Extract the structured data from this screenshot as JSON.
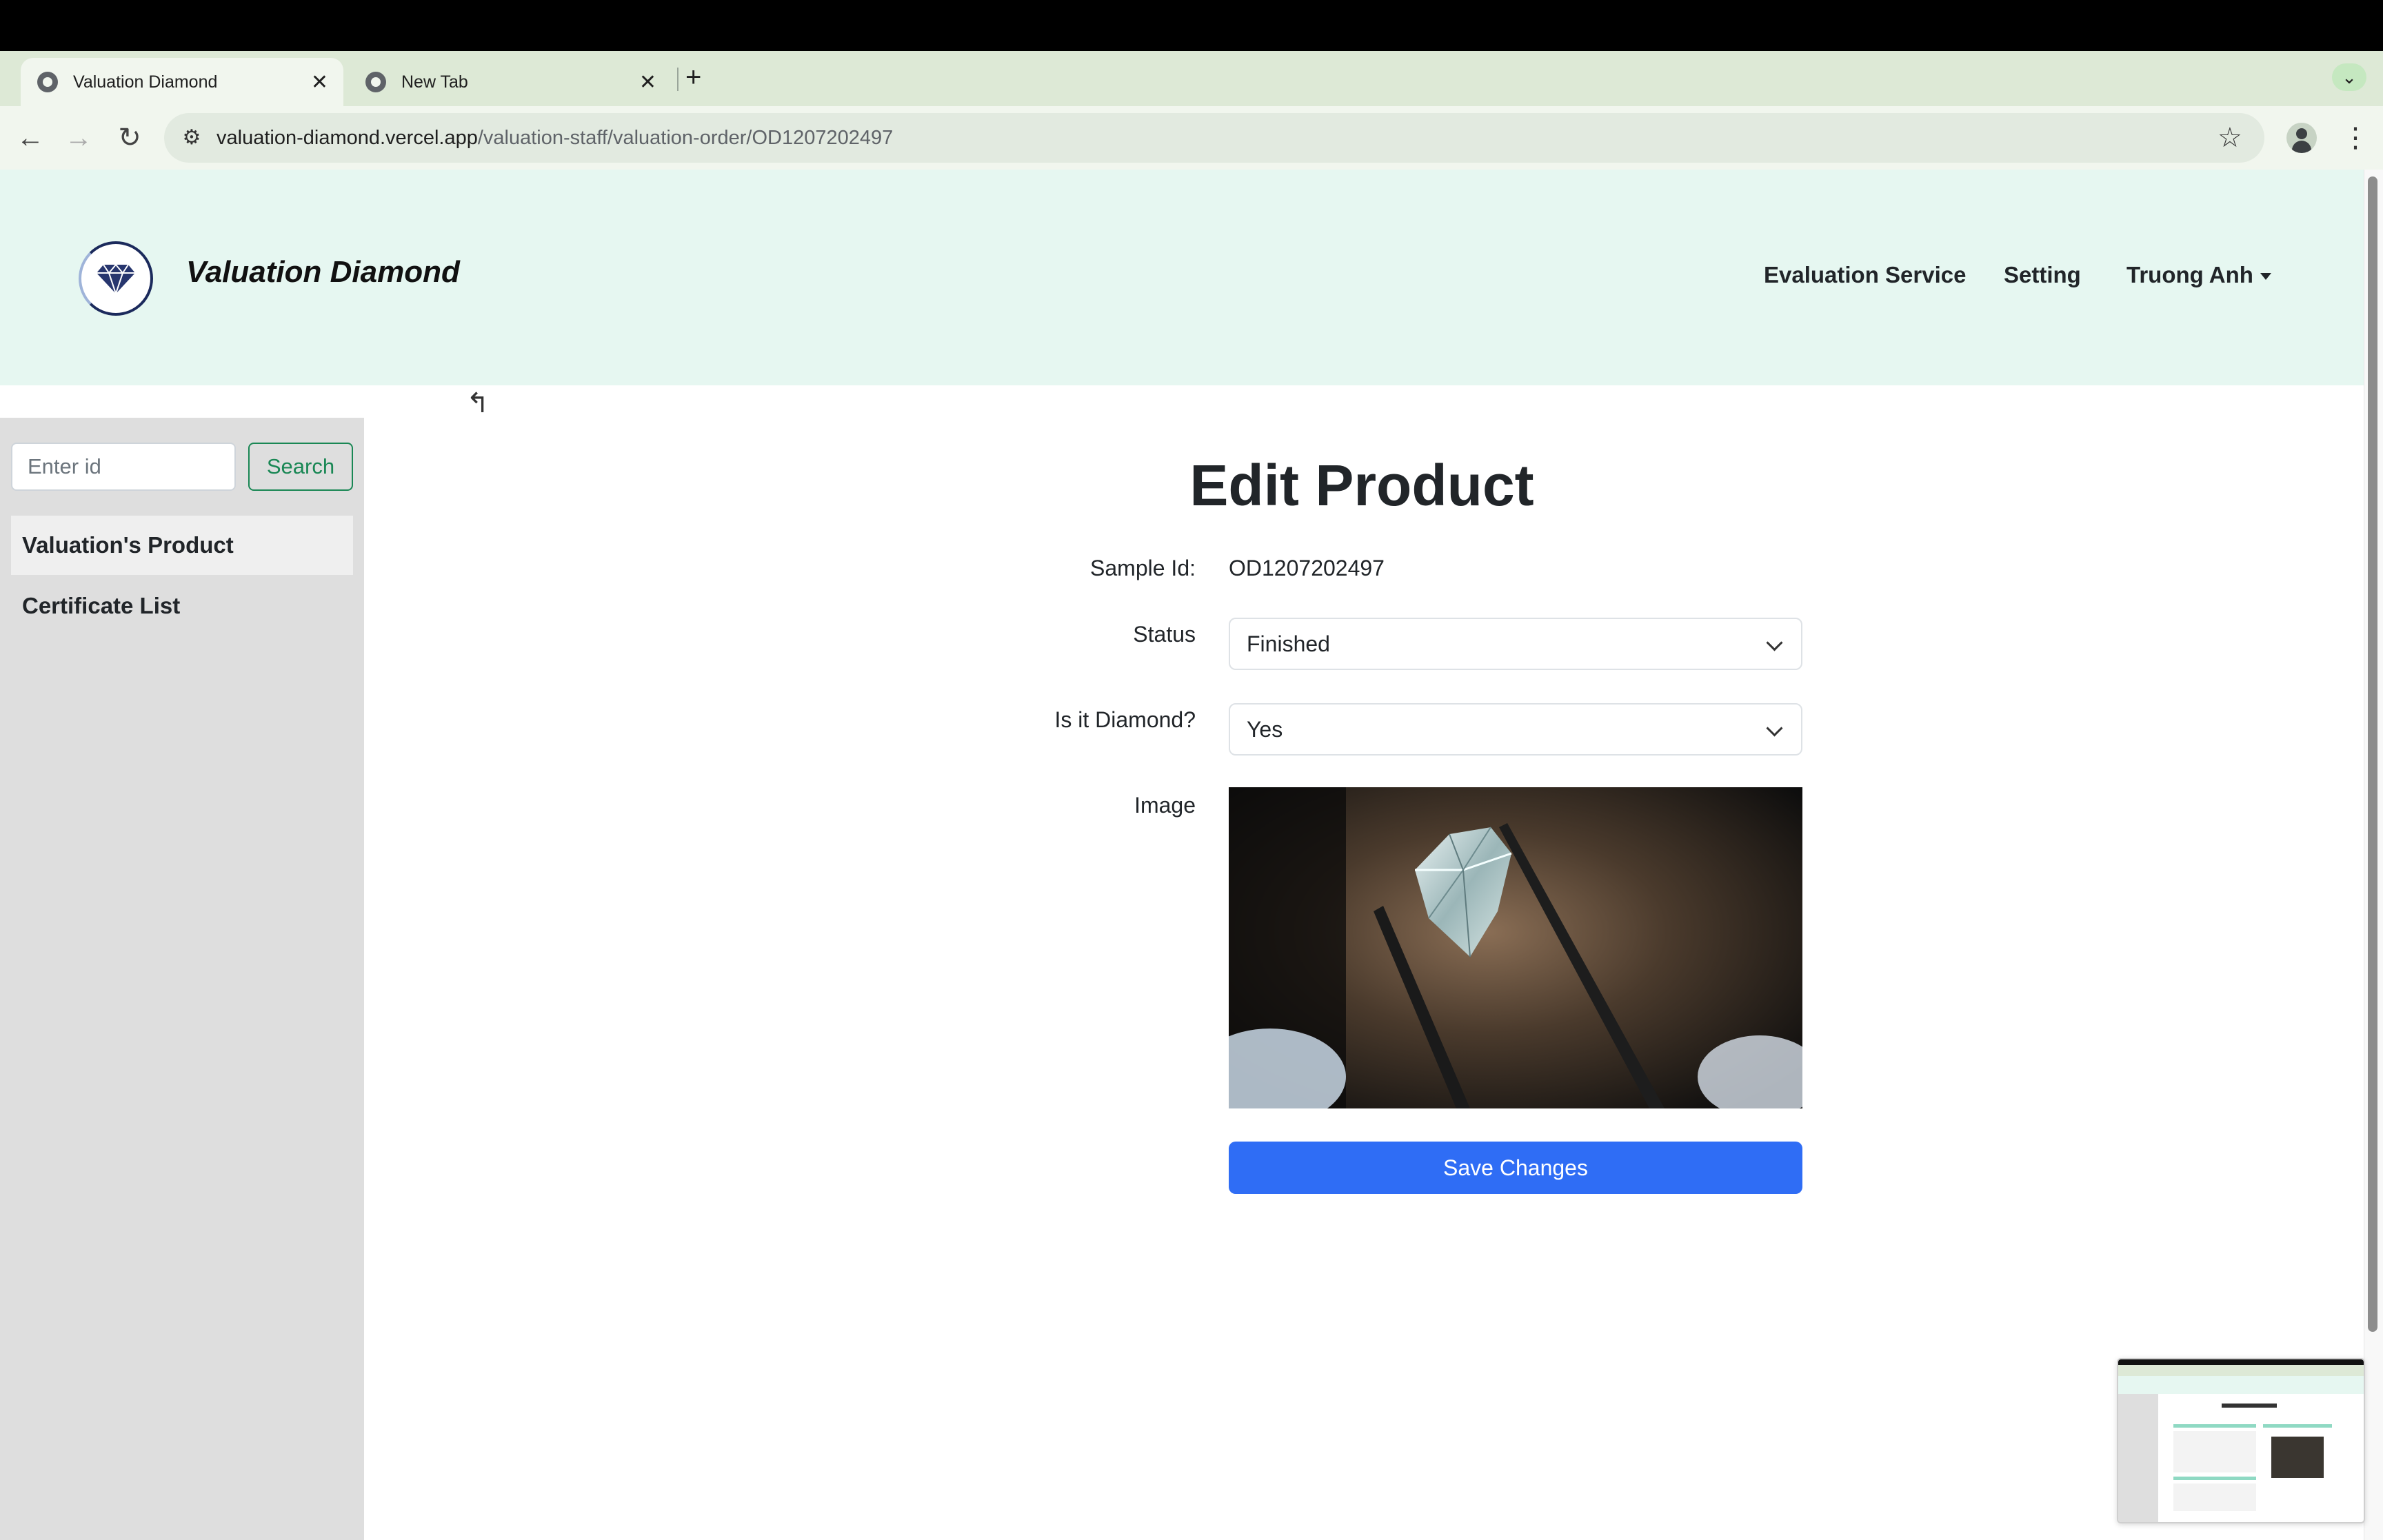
{
  "browser": {
    "tabs": [
      {
        "title": "Valuation Diamond",
        "active": true
      },
      {
        "title": "New Tab",
        "active": false
      }
    ],
    "url_host": "valuation-diamond.vercel.app",
    "url_path": "/valuation-staff/valuation-order/OD1207202497"
  },
  "header": {
    "brand": "Valuation Diamond",
    "nav": {
      "evaluation_service": "Evaluation Service",
      "setting": "Setting",
      "user": "Truong Anh"
    }
  },
  "sidebar": {
    "search_placeholder": "Enter id",
    "search_button": "Search",
    "items": [
      {
        "label": "Valuation's Product",
        "active": true
      },
      {
        "label": "Certificate List",
        "active": false
      }
    ]
  },
  "main": {
    "back_icon": "return-arrow-icon",
    "title": "Edit Product",
    "sample_id_label": "Sample Id:",
    "sample_id_value": "OD1207202497",
    "status_label": "Status",
    "status_value": "Finished",
    "is_diamond_label": "Is it Diamond?",
    "is_diamond_value": "Yes",
    "image_label": "Image",
    "save_button": "Save Changes"
  },
  "colors": {
    "header_bg": "#e6f7f1",
    "sidebar_bg": "#dedede",
    "primary": "#2f6df5",
    "search_green": "#198754"
  }
}
